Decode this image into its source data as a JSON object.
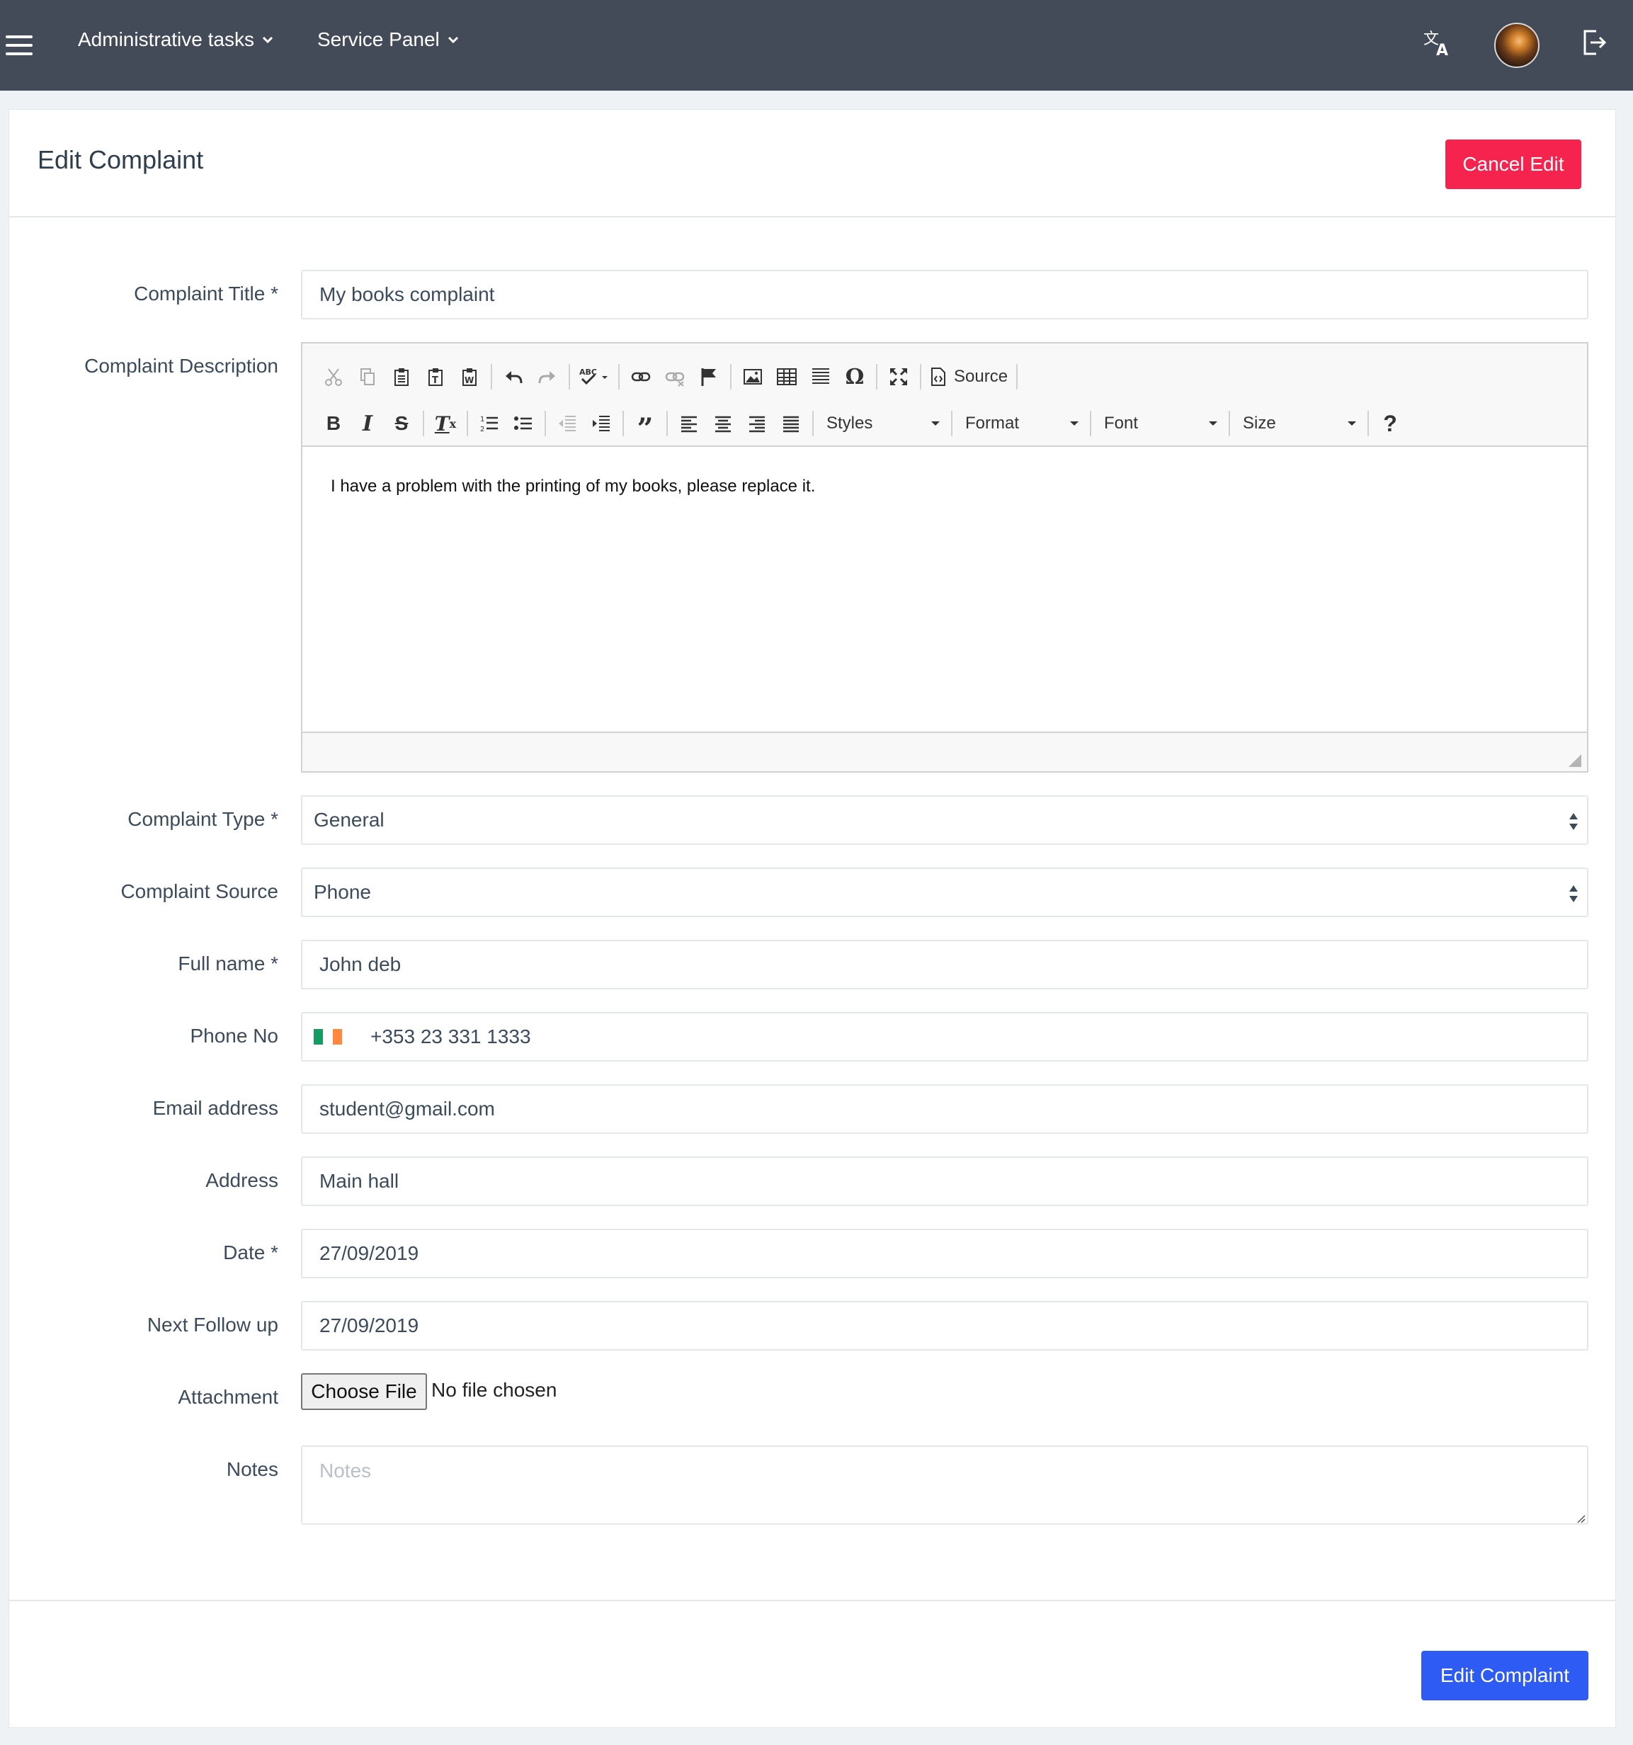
{
  "nav": {
    "menu1": "Administrative tasks",
    "menu2": "Service Panel"
  },
  "header": {
    "title": "Edit Complaint",
    "cancel_label": "Cancel Edit"
  },
  "form": {
    "title_label": "Complaint Title *",
    "title_value": "My books complaint",
    "description_label": "Complaint Description",
    "description_value": "I have a problem with the printing of my books, please replace it.",
    "type_label": "Complaint Type *",
    "type_value": "General",
    "source_label": "Complaint Source",
    "source_value": "Phone",
    "fullname_label": "Full name *",
    "fullname_value": "John deb",
    "phone_label": "Phone No",
    "phone_value": "+353 23 331 1333",
    "email_label": "Email address",
    "email_value": "student@gmail.com",
    "address_label": "Address",
    "address_value": "Main hall",
    "date_label": "Date *",
    "date_value": "27/09/2019",
    "followup_label": "Next Follow up",
    "followup_value": "27/09/2019",
    "attachment_label": "Attachment",
    "choose_file_label": "Choose File",
    "file_status": "No file chosen",
    "notes_label": "Notes",
    "notes_placeholder": "Notes",
    "submit_label": "Edit Complaint"
  },
  "editor": {
    "source_label": "Source",
    "styles_label": "Styles",
    "format_label": "Format",
    "font_label": "Font",
    "size_label": "Size"
  },
  "colors": {
    "topbar": "#444b58",
    "cancel": "#f5234d",
    "primary": "#2d5bf4",
    "flag": [
      "#169b62",
      "#ffffff",
      "#ff883e"
    ]
  }
}
